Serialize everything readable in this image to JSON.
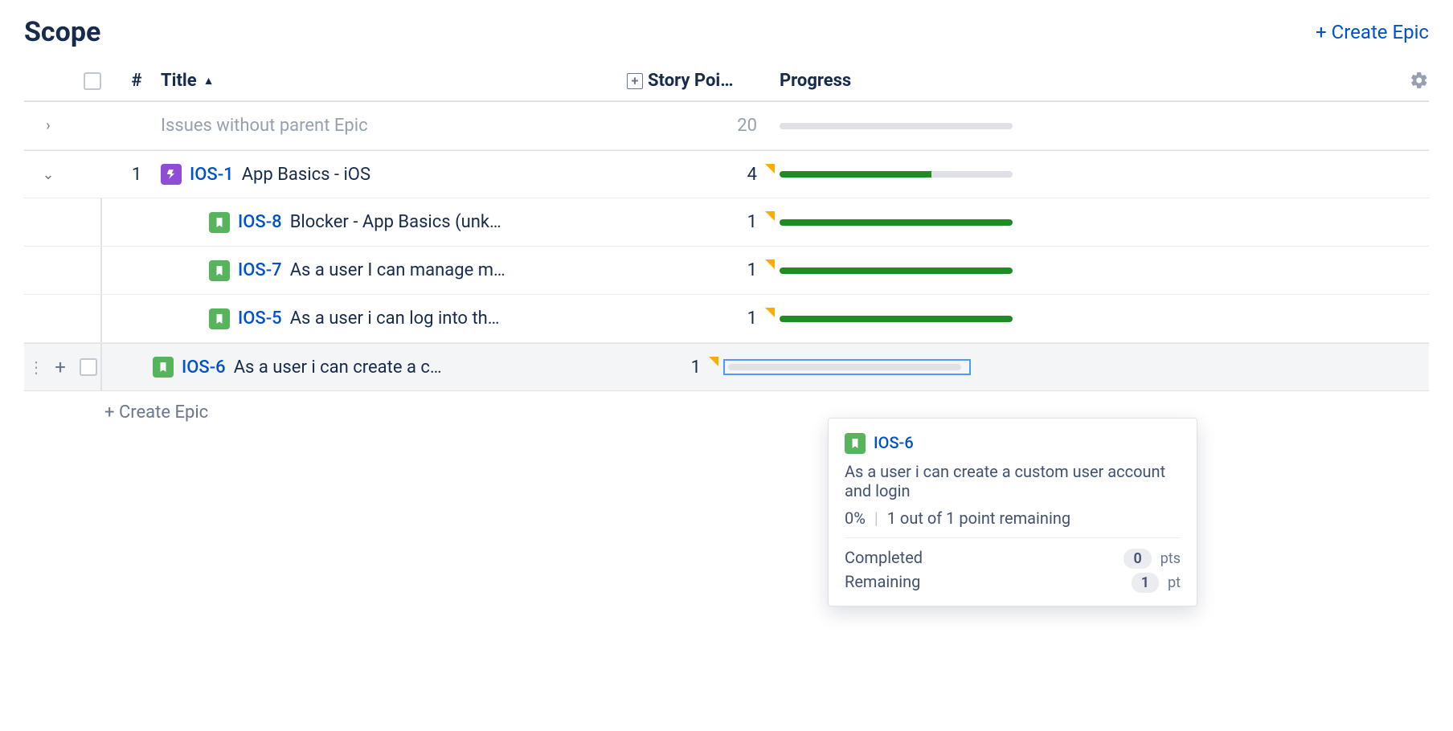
{
  "header": {
    "scope_label": "Scope",
    "create_epic_label": "+ Create Epic"
  },
  "columns": {
    "hash": "#",
    "title": "Title",
    "sort_indicator": "▲",
    "story_points": "Story Poi…",
    "progress": "Progress"
  },
  "rows": {
    "no_epic": {
      "title": "Issues without parent Epic",
      "points": "20",
      "progress": 0
    },
    "epic": {
      "num": "1",
      "key": "IOS-1",
      "title": "App Basics - iOS",
      "points": "4",
      "progress": 65
    },
    "children": [
      {
        "key": "IOS-8",
        "title": "Blocker - App Basics (unk…",
        "points": "1",
        "progress": 100
      },
      {
        "key": "IOS-7",
        "title": "As a user I can manage m…",
        "points": "1",
        "progress": 100
      },
      {
        "key": "IOS-5",
        "title": "As a user i can log into th…",
        "points": "1",
        "progress": 100
      },
      {
        "key": "IOS-6",
        "title": "As a user i can create a c…",
        "points": "1",
        "progress": 0,
        "selected": true
      }
    ]
  },
  "footer": {
    "create_epic": "+ Create Epic"
  },
  "tooltip": {
    "key": "IOS-6",
    "title": "As a user i can create a custom user account and login",
    "percent": "0%",
    "remaining_text": "1 out of 1 point remaining",
    "completed_label": "Completed",
    "completed_value": "0",
    "completed_unit": "pts",
    "remaining_label": "Remaining",
    "remaining_value": "1",
    "remaining_unit": "pt"
  }
}
